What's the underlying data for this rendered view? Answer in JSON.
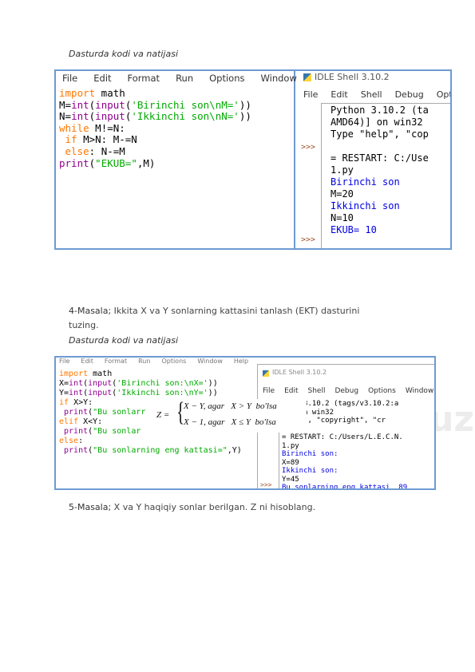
{
  "section1": {
    "heading": "Dasturda kodi va natijasi",
    "editor": {
      "menu": [
        "File",
        "Edit",
        "Format",
        "Run",
        "Options",
        "Window"
      ],
      "lines": [
        [
          {
            "t": "import",
            "c": "kw"
          },
          {
            "t": " math",
            "c": "df"
          }
        ],
        [
          {
            "t": "M=",
            "c": "df"
          },
          {
            "t": "int",
            "c": "bi"
          },
          {
            "t": "(",
            "c": "df"
          },
          {
            "t": "input",
            "c": "bi"
          },
          {
            "t": "(",
            "c": "df"
          },
          {
            "t": "'Birinchi son\\nM='",
            "c": "st"
          },
          {
            "t": "))",
            "c": "df"
          }
        ],
        [
          {
            "t": "N=",
            "c": "df"
          },
          {
            "t": "int",
            "c": "bi"
          },
          {
            "t": "(",
            "c": "df"
          },
          {
            "t": "input",
            "c": "bi"
          },
          {
            "t": "(",
            "c": "df"
          },
          {
            "t": "'Ikkinchi son\\nN='",
            "c": "st"
          },
          {
            "t": "))",
            "c": "df"
          }
        ],
        [
          {
            "t": "while",
            "c": "kw"
          },
          {
            "t": " M!=N:",
            "c": "df"
          }
        ],
        [
          {
            "t": " if",
            "c": "kw"
          },
          {
            "t": " M>N: M-=N",
            "c": "df"
          }
        ],
        [
          {
            "t": " else",
            "c": "kw"
          },
          {
            "t": ": N-=M",
            "c": "df"
          }
        ],
        [
          {
            "t": "print",
            "c": "bi"
          },
          {
            "t": "(",
            "c": "df"
          },
          {
            "t": "\"EKUB=\"",
            "c": "st"
          },
          {
            "t": ",M)",
            "c": "df"
          }
        ]
      ]
    },
    "shell": {
      "title": "IDLE Shell 3.10.2",
      "menu": [
        "File",
        "Edit",
        "Shell",
        "Debug",
        "Options"
      ],
      "prompt": ">>>",
      "lines": [
        {
          "t": "Python 3.10.2 (ta",
          "c": "df"
        },
        {
          "t": "AMD64)] on win32",
          "c": "df"
        },
        {
          "t": "Type \"help\", \"cop",
          "c": "df"
        },
        {
          "t": "",
          "c": "df"
        },
        {
          "t": "= RESTART: C:/Use",
          "c": "df"
        },
        {
          "t": "1.py",
          "c": "df"
        },
        {
          "t": "Birinchi son",
          "c": "out"
        },
        {
          "t": "M=20",
          "c": "df"
        },
        {
          "t": "Ikkinchi son",
          "c": "out"
        },
        {
          "t": "N=10",
          "c": "df"
        },
        {
          "t": "EKUB= 10",
          "c": "out"
        }
      ]
    }
  },
  "task4": {
    "label": "4-Masala;",
    "text": " Ikkita X va Y sonlarning kattasini tanlash (EKT) dasturini",
    "text2": "tuzing."
  },
  "section2": {
    "heading": "Dasturda kodi va natijasi",
    "editor": {
      "menu": [
        "File",
        "Edit",
        "Format",
        "Run",
        "Options",
        "Window",
        "Help"
      ],
      "lines": [
        [
          {
            "t": "import",
            "c": "kw"
          },
          {
            "t": " math",
            "c": "df"
          }
        ],
        [
          {
            "t": "X=",
            "c": "df"
          },
          {
            "t": "int",
            "c": "bi"
          },
          {
            "t": "(",
            "c": "df"
          },
          {
            "t": "input",
            "c": "bi"
          },
          {
            "t": "(",
            "c": "df"
          },
          {
            "t": "'Birinchi son:\\nX='",
            "c": "st"
          },
          {
            "t": "))",
            "c": "df"
          }
        ],
        [
          {
            "t": "Y=",
            "c": "df"
          },
          {
            "t": "int",
            "c": "bi"
          },
          {
            "t": "(",
            "c": "df"
          },
          {
            "t": "input",
            "c": "bi"
          },
          {
            "t": "(",
            "c": "df"
          },
          {
            "t": "'Ikkinchi son:\\nY='",
            "c": "st"
          },
          {
            "t": "))",
            "c": "df"
          }
        ],
        [
          {
            "t": "if",
            "c": "kw"
          },
          {
            "t": " X>Y:",
            "c": "df"
          }
        ],
        [
          {
            "t": " print",
            "c": "bi"
          },
          {
            "t": "(",
            "c": "df"
          },
          {
            "t": "\"Bu sonlarr",
            "c": "st"
          }
        ],
        [
          {
            "t": "elif",
            "c": "kw"
          },
          {
            "t": " X<Y:",
            "c": "df"
          }
        ],
        [
          {
            "t": " print",
            "c": "bi"
          },
          {
            "t": "(",
            "c": "df"
          },
          {
            "t": "\"Bu sonlar",
            "c": "st"
          }
        ],
        [
          {
            "t": "else",
            "c": "kw"
          },
          {
            "t": ":",
            "c": "df"
          }
        ],
        [
          {
            "t": " print",
            "c": "bi"
          },
          {
            "t": "(",
            "c": "df"
          },
          {
            "t": "\"Bu sonlarning eng kattasi=\"",
            "c": "st"
          },
          {
            "t": ",Y)",
            "c": "df"
          }
        ]
      ]
    },
    "shell": {
      "title": "IDLE Shell 3.10.2",
      "menu": [
        "File",
        "Edit",
        "Shell",
        "Debug",
        "Options",
        "Window"
      ],
      "prompt": ">>>",
      "lines": [
        {
          "t": "thon 3.10.2 (tags/v3.10.2:a",
          "c": "df"
        },
        {
          "t": "4)] on win32",
          "c": "df"
        },
        {
          "t": "\"help\", \"copyright\", \"cr",
          "c": "df"
        },
        {
          "t": "",
          "c": "df"
        },
        {
          "t": "= RESTART: C:/Users/L.E.C.N.",
          "c": "df"
        },
        {
          "t": "1.py",
          "c": "df"
        },
        {
          "t": "Birinchi son:",
          "c": "out"
        },
        {
          "t": "X=89",
          "c": "df"
        },
        {
          "t": "Ikkinchi son:",
          "c": "out"
        },
        {
          "t": "Y=45",
          "c": "df"
        },
        {
          "t": "Bu sonlarning eng kattasi  89",
          "c": "out"
        }
      ]
    },
    "formula": {
      "lhs": "Z =",
      "row1": "X − Y, agar   X > Y  bo'lsa",
      "row2": "X − 1, agar   X ≤ Y  bo'lsa"
    }
  },
  "task5": {
    "label": "5-Masala;",
    "text": " X va Y haqiqiy sonlar berilgan. Z ni hisoblang."
  },
  "watermark": "oefen.uz",
  "colors": {
    "frame": "#6e9bd3",
    "keyword": "#ff7700",
    "builtin": "#900090",
    "string": "#00aa00",
    "output": "#0000e0"
  }
}
